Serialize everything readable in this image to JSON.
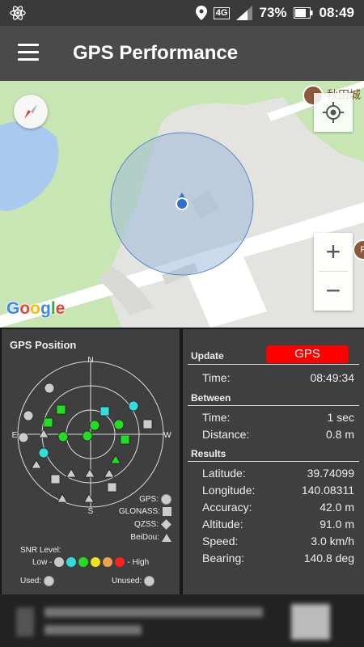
{
  "status_bar": {
    "network": "4G",
    "battery": "73%",
    "time": "08:49"
  },
  "app_bar": {
    "title": "GPS Performance",
    "menu_icon": "hamburger-menu-icon"
  },
  "map": {
    "place_label": "秋田城",
    "google_logo": [
      "G",
      "o",
      "o",
      "g",
      "l",
      "e"
    ],
    "zoom_in": "+",
    "zoom_out": "−",
    "poi_badge": "P"
  },
  "gps_position": {
    "title": "GPS Position",
    "directions": {
      "n": "N",
      "s": "S",
      "e": "E",
      "w": "W"
    },
    "legend": {
      "gps": "GPS:",
      "glonass": "GLONASS:",
      "qzss": "QZSS:",
      "beidou": "BeiDou:"
    },
    "snr_label": "SNR Level:",
    "snr_low": "Low -",
    "snr_high": "- High",
    "snr_colors": [
      "#c8c8c8",
      "#33dddd",
      "#22dd22",
      "#f0e020",
      "#f0a050",
      "#ff2020"
    ],
    "used_label": "Used:",
    "unused_label": "Unused:"
  },
  "update": {
    "label": "Update",
    "button": "GPS",
    "time_label": "Time:",
    "time_value": "08:49:34"
  },
  "between": {
    "label": "Between",
    "time_label": "Time:",
    "time_value": "1 sec",
    "distance_label": "Distance:",
    "distance_value": "0.8 m"
  },
  "results": {
    "label": "Results",
    "rows": [
      {
        "label": "Latitude:",
        "value": "39.74099"
      },
      {
        "label": "Longitude:",
        "value": "140.08311"
      },
      {
        "label": "Accuracy:",
        "value": "42.0 m"
      },
      {
        "label": "Altitude:",
        "value": "91.0 m"
      },
      {
        "label": "Speed:",
        "value": "3.0 km/h"
      },
      {
        "label": "Bearing:",
        "value": "140.8 deg"
      }
    ]
  },
  "colors": {
    "accent_red": "#ff0000",
    "panel_bg": "#3f3f3f",
    "appbar": "#4a4a4a"
  }
}
